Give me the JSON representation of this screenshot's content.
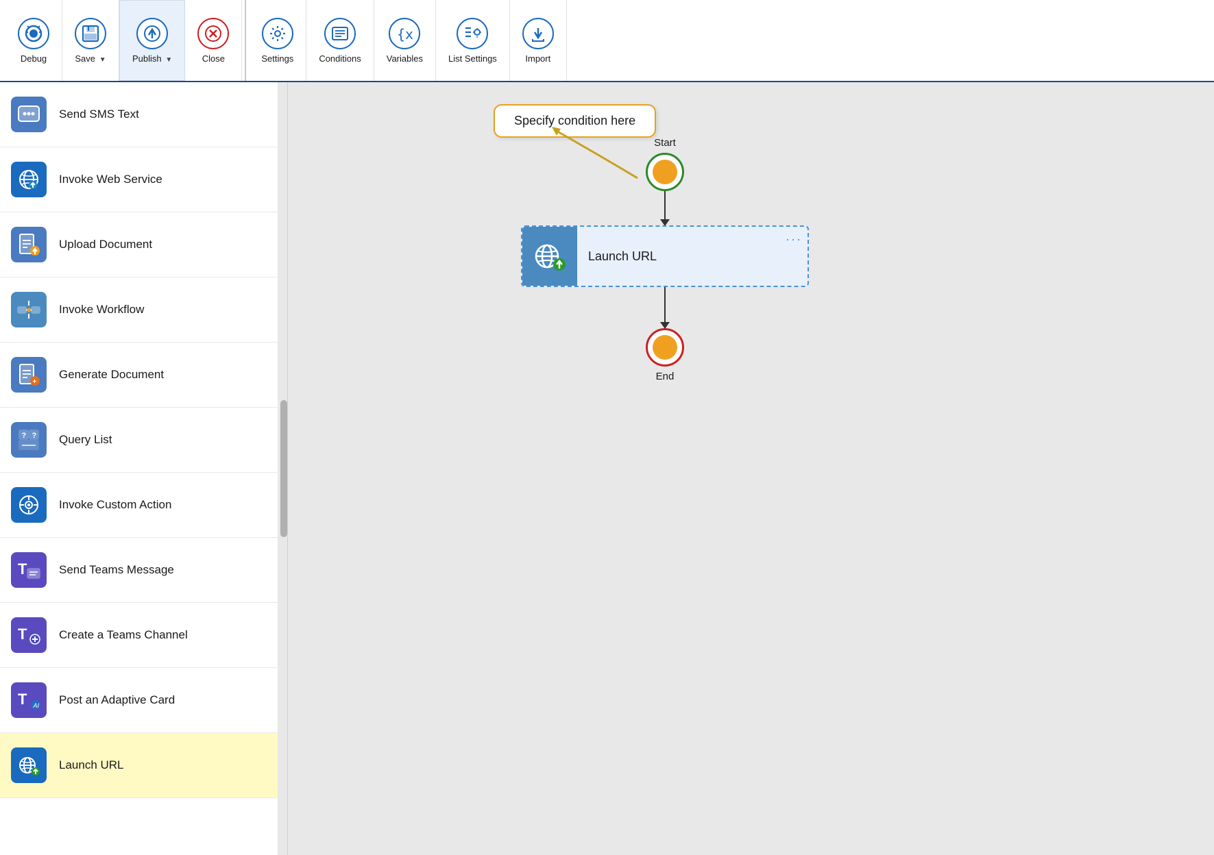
{
  "toolbar": {
    "buttons": [
      {
        "id": "debug",
        "label": "Debug",
        "icon": "debug"
      },
      {
        "id": "save",
        "label": "Save",
        "icon": "save",
        "dropdown": true
      },
      {
        "id": "publish",
        "label": "Publish",
        "icon": "publish",
        "dropdown": true
      },
      {
        "id": "close",
        "label": "Close",
        "icon": "close"
      }
    ],
    "right_buttons": [
      {
        "id": "settings",
        "label": "Settings",
        "icon": "settings"
      },
      {
        "id": "conditions",
        "label": "Conditions",
        "icon": "conditions"
      },
      {
        "id": "variables",
        "label": "Variables",
        "icon": "variables"
      },
      {
        "id": "list-settings",
        "label": "List Settings",
        "icon": "list-settings"
      },
      {
        "id": "import",
        "label": "Import",
        "icon": "import"
      }
    ]
  },
  "actions": [
    {
      "id": "send-sms",
      "label": "Send SMS Text",
      "icon": "sms",
      "color": "#4a7abf"
    },
    {
      "id": "invoke-web-service",
      "label": "Invoke Web Service",
      "icon": "web",
      "color": "#1a6abf"
    },
    {
      "id": "upload-document",
      "label": "Upload Document",
      "icon": "upload-doc",
      "color": "#4a7abf"
    },
    {
      "id": "invoke-workflow",
      "label": "Invoke Workflow",
      "icon": "workflow",
      "color": "#4a8abf"
    },
    {
      "id": "generate-document",
      "label": "Generate Document",
      "icon": "gen-doc",
      "color": "#4a7abf"
    },
    {
      "id": "query-list",
      "label": "Query List",
      "icon": "query",
      "color": "#4a7abf"
    },
    {
      "id": "invoke-custom-action",
      "label": "Invoke Custom Action",
      "icon": "custom-action",
      "color": "#1a6abf"
    },
    {
      "id": "send-teams-message",
      "label": "Send Teams Message",
      "icon": "teams-msg",
      "color": "#5a4abf"
    },
    {
      "id": "create-teams-channel",
      "label": "Create a Teams Channel",
      "icon": "teams-channel",
      "color": "#5a4abf"
    },
    {
      "id": "post-adaptive-card",
      "label": "Post an Adaptive Card",
      "icon": "adaptive-card",
      "color": "#5a4abf"
    },
    {
      "id": "launch-url",
      "label": "Launch URL",
      "icon": "launch-url",
      "color": "#1a6abf",
      "selected": true
    }
  ],
  "canvas": {
    "condition_tooltip": "Specify condition here",
    "start_label": "Start",
    "end_label": "End",
    "action_node_label": "Launch URL",
    "action_node_menu": "···"
  }
}
